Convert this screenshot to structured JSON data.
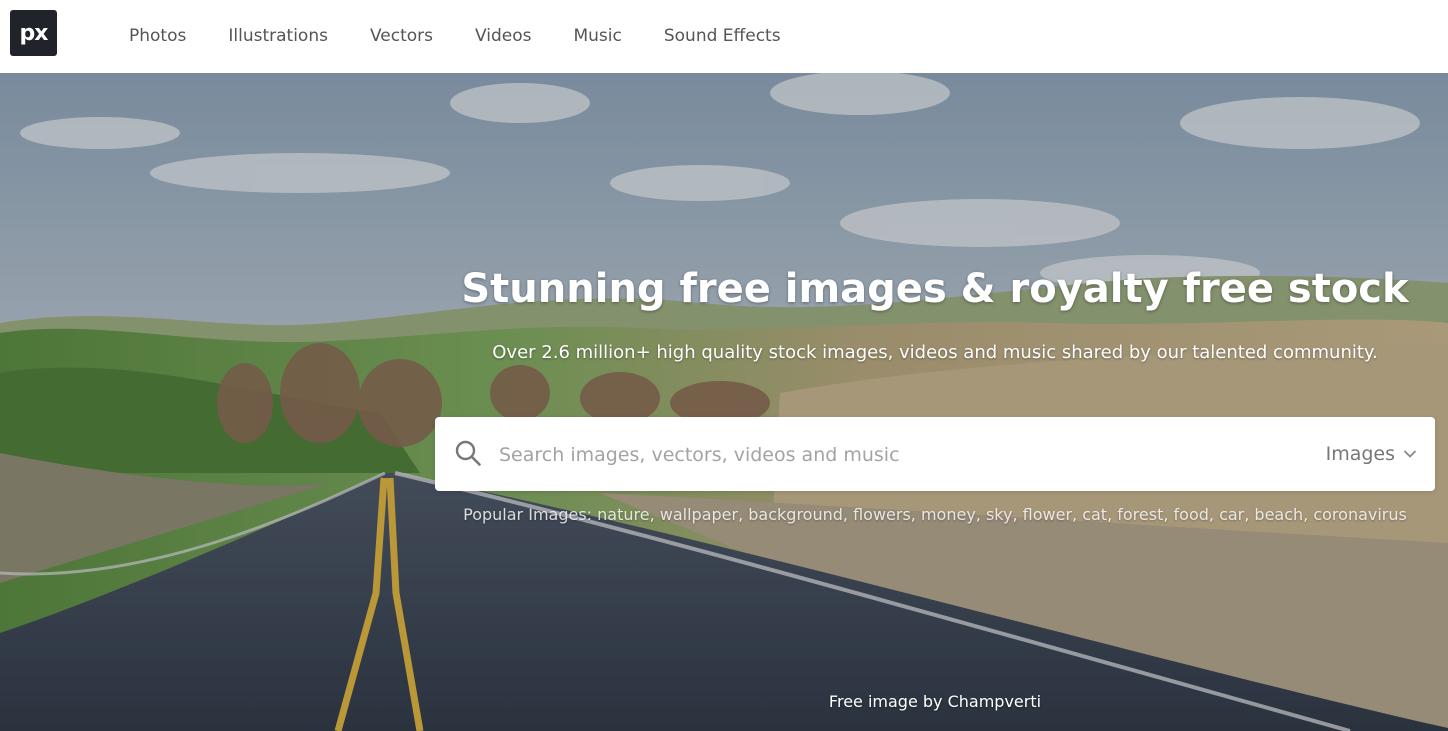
{
  "logo": {
    "text": "px"
  },
  "nav": {
    "items": [
      {
        "label": "Photos"
      },
      {
        "label": "Illustrations"
      },
      {
        "label": "Vectors"
      },
      {
        "label": "Videos"
      },
      {
        "label": "Music"
      },
      {
        "label": "Sound Effects"
      }
    ]
  },
  "hero": {
    "headline": "Stunning free images & royalty free stock",
    "subline": "Over 2.6 million+ high quality stock images, videos and music shared by our talented community.",
    "search": {
      "value": "",
      "placeholder": "Search images, vectors, videos and music",
      "type_selected": "Images"
    },
    "popular": {
      "prefix": "Popular Images:",
      "terms": [
        "nature",
        "wallpaper",
        "background",
        "flowers",
        "money",
        "sky",
        "flower",
        "cat",
        "forest",
        "food",
        "car",
        "beach",
        "coronavirus"
      ]
    },
    "credit": "Free image by Champverti"
  },
  "colors": {
    "logo_bg": "#20232a",
    "nav_text": "#555555",
    "road_line": "#e0b43a"
  },
  "icons": {
    "search": "search-icon",
    "dropdown": "chevron-down-icon"
  }
}
